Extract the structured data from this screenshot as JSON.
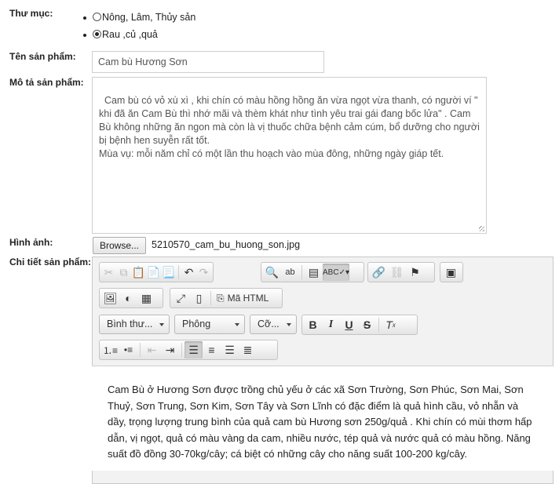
{
  "labels": {
    "category": "Thư mục:",
    "product_name": "Tên sản phẩm:",
    "description": "Mô tả sản phẩm:",
    "image": "Hình ảnh:",
    "details": "Chi tiết sản phẩm:"
  },
  "categories": [
    {
      "label": "Nông, Lâm, Thủy sản",
      "selected": false
    },
    {
      "label": "Rau ,củ ,quả",
      "selected": true
    }
  ],
  "product_name_value": "Cam bù Hương Sơn",
  "description_value": "Cam bù có vỏ xù xì , khi chín có màu hồng hồng ăn vừa ngọt vừa thanh, có người ví \" khi đã ăn Cam Bù thì nhớ mãi và thèm khát như tình yêu trai gái đang bốc lửa\" . Cam Bù không những ăn ngon mà còn là vị thuốc chữa bệnh cảm cúm, bổ dưỡng cho người bị bệnh hen suyễn rất tốt.\nMùa vụ: mỗi năm chỉ có một lần thu hoạch vào mùa đông, những ngày giáp tết.",
  "file": {
    "browse_label": "Browse...",
    "file_name": "5210570_cam_bu_huong_son.jpg"
  },
  "editor": {
    "html_source_label": "Mã HTML",
    "format_combo": "Bình thư...",
    "font_combo": "Phông",
    "size_combo": "Cỡ...",
    "content": "Cam Bù ở Hương Sơn được trồng chủ yếu ở các xã Sơn Trường, Sơn Phúc, Sơn Mai, Sơn Thuỷ, Sơn Trung, Sơn Kim, Sơn Tây và Sơn Lĩnh có đặc điểm là quả hình cầu, vỏ nhẵn và dầy, trọng lượng trung bình của quả cam bù Hương sơn 250g/quả . Khi chín có mùi thơm hấp dẫn, vị ngọt, quả có màu vàng da cam, nhiều nước, tép quả và nước quả có màu hồng. Năng suất đồ đồng 30-70kg/cây; cá biệt có những cây cho năng suất 100-200 kg/cây."
  }
}
